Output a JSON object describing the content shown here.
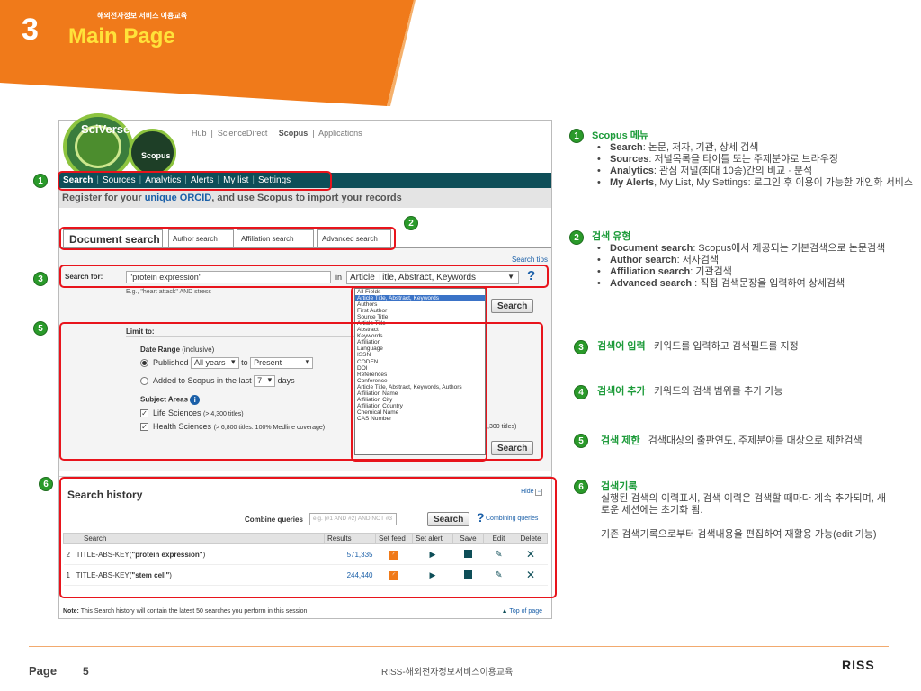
{
  "slide": {
    "number": "3",
    "subtitle": "해외전자정보 서비스 이용교육",
    "title": "Main Page",
    "accent_color": "#f07a1a"
  },
  "scopus": {
    "logo_sciverse": "SciVerse",
    "logo_scopus": "Scopus",
    "top_links": [
      "Hub",
      "ScienceDirect",
      "Scopus",
      "Applications"
    ],
    "nav": [
      "Search",
      "Sources",
      "Analytics",
      "Alerts",
      "My list",
      "Settings"
    ],
    "orcid": {
      "pre": "Register for your ",
      "link": "unique ORCID",
      "post": ", and use Scopus to import your records"
    },
    "tabs": [
      "Document search",
      "Author search",
      "Affiliation search",
      "Advanced search"
    ],
    "search_tips": "Search tips",
    "search_for_label": "Search for:",
    "search_value": "\"protein expression\"",
    "in_label": "in",
    "field_selected": "Article Title, Abstract, Keywords",
    "example": "E.g., \"heart attack\" AND stress",
    "field_options": [
      "All Fields",
      "Article Title, Abstract, Keywords",
      "Authors",
      "First Author",
      "Source Title",
      "Article Title",
      "Abstract",
      "Keywords",
      "Affiliation",
      "Language",
      "ISSN",
      "CODEN",
      "DOI",
      "References",
      "Conference",
      "Article Title, Abstract, Keywords, Authors",
      "Affiliation Name",
      "Affiliation City",
      "Affiliation Country",
      "Chemical Name",
      "CAS Number"
    ],
    "search_button": "Search",
    "limit_to": "Limit to:",
    "date_range": "Date Range",
    "inclusive": "(inclusive)",
    "published": "Published",
    "all_years": "All years",
    "to": "to",
    "present": "Present",
    "added_to_scopus": "Added to Scopus in the last",
    "days_value": "7",
    "days": "days",
    "subject_areas": "Subject Areas",
    "life_sciences": "Life Sciences",
    "life_sciences_count": "(> 4,300 titles)",
    "health_sciences": "Health Sciences",
    "health_sciences_count": "(> 6,800 titles. 100% Medline coverage)",
    "extra_count": ",300 titles)",
    "history": {
      "title": "Search history",
      "hide": "Hide",
      "combine_label": "Combine queries",
      "combine_placeholder": "e.g. (#1 AND #2) AND NOT #3",
      "combine_button": "Search",
      "combining_queries": "Combining queries",
      "columns": [
        "Search",
        "Results",
        "Set feed",
        "Set alert",
        "Save",
        "Edit",
        "Delete"
      ],
      "rows": [
        {
          "n": "2",
          "prefix": "TITLE-ABS-KEY(",
          "term": "\"protein expression\"",
          "suffix": ")",
          "results": "571,335"
        },
        {
          "n": "1",
          "prefix": "TITLE-ABS-KEY(",
          "term": "\"stem cell\"",
          "suffix": ")",
          "results": "244,440"
        }
      ],
      "note_bold": "Note:",
      "note": " This Search history will contain the latest 50 searches you perform in this session.",
      "top_of_page": "Top of page"
    }
  },
  "annotations": [
    {
      "n": "1",
      "heading": "Scopus 메뉴",
      "items": [
        {
          "b": "Search",
          "t": ": 논문, 저자, 기관, 상세 검색"
        },
        {
          "b": "Sources",
          "t": ": 저널목록을 타이틀 또는 주제분야로 브라우징"
        },
        {
          "b": "Analytics",
          "t": ": 관심 저널(최대 10종)간의 비교 · 분석"
        },
        {
          "b": "My Alerts",
          "t": ", My List, My Settings: 로그인 후 이용이 가능한 개인화 서비스"
        }
      ]
    },
    {
      "n": "2",
      "heading": "검색 유형",
      "items": [
        {
          "b": "Document search",
          "t": ": Scopus에서 제공되는 기본검색으로 논문검색"
        },
        {
          "b": "Author search",
          "t": ": 저자검색"
        },
        {
          "b": "Affiliation search",
          "t": ": 기관검색"
        },
        {
          "b": "Advanced search",
          "t": " : 직접 검색문장을 입력하여 상세검색"
        }
      ]
    },
    {
      "n": "3",
      "heading": "검색어 입력",
      "text": "키워드를 입력하고 검색필드를 지정"
    },
    {
      "n": "4",
      "heading": "검색어 추가",
      "text": "키워드와 검색 범위를 추가 가능"
    },
    {
      "n": "5",
      "heading": "검색 제한",
      "text": "검색대상의 출판연도, 주제분야를 대상으로 제한검색"
    },
    {
      "n": "6",
      "heading": "검색기록",
      "text": "실행된 검색의 이력표시, 검색 이력은 검색할 때마다 계속 추가되며, 새로운 세션에는 초기화 됨.",
      "text2": "기존 검색기록으로부터 검색내용을 편집하여 재활용 가능(edit 기능)"
    }
  ],
  "footer": {
    "page_label": "Page",
    "page_number": "5",
    "center": "RISS-해외전자정보서비스이용교육",
    "logo": "RISS"
  }
}
